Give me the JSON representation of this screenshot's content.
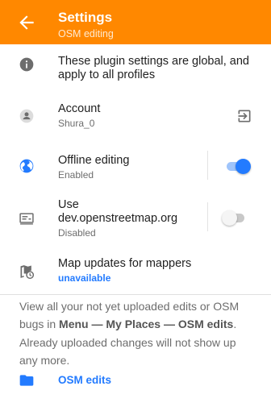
{
  "appbar": {
    "title": "Settings",
    "subtitle": "OSM editing",
    "back_icon": "arrow-left-icon",
    "bg_color": "#ff8800"
  },
  "info_row": {
    "icon": "info-icon",
    "text_line1": "These plugin settings are global, and",
    "text_line2": "apply to all profiles"
  },
  "account_row": {
    "icon": "person-icon",
    "title": "Account",
    "value": "Shura_0",
    "action_icon": "logout-icon"
  },
  "offline_row": {
    "icon": "globe-icon",
    "title": "Offline editing",
    "status": "Enabled",
    "toggle_on": true
  },
  "dev_row": {
    "icon": "server-icon",
    "title_line1": "Use",
    "title_line2": "dev.openstreetmap.org",
    "status": "Disabled",
    "toggle_on": false
  },
  "map_updates_row": {
    "icon": "map-update-icon",
    "title": "Map updates for mappers",
    "status": "unavailable"
  },
  "description": {
    "part1": "View all your not yet uploaded edits or OSM bugs in ",
    "bold": "Menu — My Places — OSM edits",
    "part2": ". Already uploaded changes will not show up any more."
  },
  "osm_edits_link": {
    "icon": "folder-icon",
    "label": "OSM edits"
  },
  "colors": {
    "accent": "#ff8800",
    "link": "#237bff",
    "toggle_on": "#237bff"
  }
}
